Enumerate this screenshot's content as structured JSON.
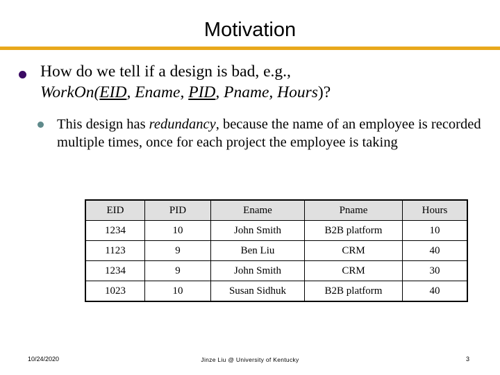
{
  "slide": {
    "title": "Motivation",
    "accent_color": "#E8A81C",
    "bullet1_color": "#3B0B63",
    "bullet2_color": "#5F8A8B"
  },
  "bullets": {
    "level1": {
      "line1": "How do we tell if a design is bad, e.g.,",
      "relation_name": "WorkOn(",
      "attr_eid": "EID",
      "sep1": ", ",
      "attr_ename": "Ename",
      "sep2": ", ",
      "attr_pid": "PID",
      "sep3": ", ",
      "attr_pname": "Pname",
      "sep4": ", ",
      "attr_hours": "Hours",
      "closing": ")?"
    },
    "level2": {
      "part1": "This design has ",
      "emphasis": "redundancy",
      "part2": ", because the name of an employee is recorded multiple times, once for each project the employee is taking"
    }
  },
  "table": {
    "headers": [
      "EID",
      "PID",
      "Ename",
      "Pname",
      "Hours"
    ],
    "rows": [
      [
        "1234",
        "10",
        "John Smith",
        "B2B platform",
        "10"
      ],
      [
        "1123",
        "9",
        "Ben Liu",
        "CRM",
        "40"
      ],
      [
        "1234",
        "9",
        "John Smith",
        "CRM",
        "30"
      ],
      [
        "1023",
        "10",
        "Susan Sidhuk",
        "B2B platform",
        "40"
      ]
    ]
  },
  "footer": {
    "date": "10/24/2020",
    "attribution": "Jinze Liu @ University of Kentucky",
    "page_number": "3"
  }
}
